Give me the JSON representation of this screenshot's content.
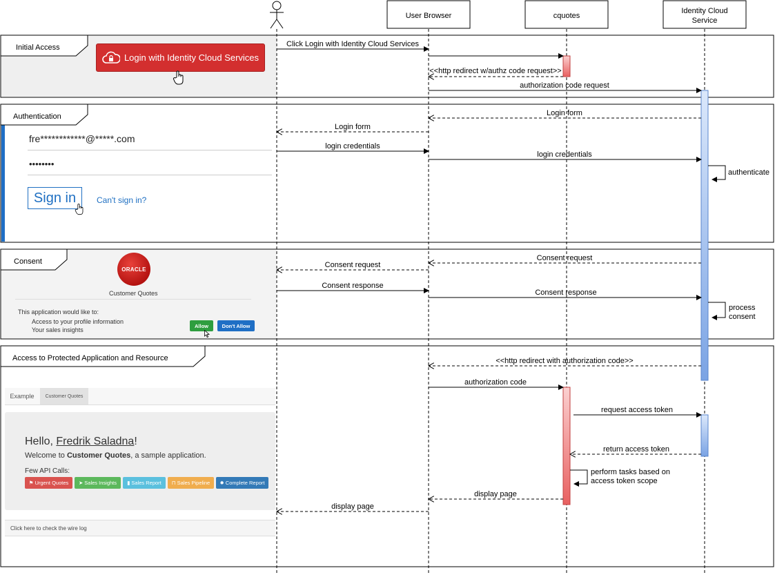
{
  "participants": [
    {
      "id": "user",
      "label": ""
    },
    {
      "id": "browser",
      "label": "User Browser"
    },
    {
      "id": "cquotes",
      "label": "cquotes"
    },
    {
      "id": "idcs",
      "label": "Identity Cloud Service"
    }
  ],
  "idcs_label_lines": [
    "Identity Cloud",
    "Service"
  ],
  "sections": {
    "initial_access": "Initial Access",
    "authentication": "Authentication",
    "consent": "Consent",
    "access_protected": "Access to Protected Application and Resource"
  },
  "messages": {
    "m1": "Click Login with Identity Cloud Services",
    "m3": "<<http redirect w/authz code request>>",
    "m4": "authorization code request",
    "m5": "Login form",
    "m6": "Login form",
    "m7": "login credentials",
    "m8": "login credentials",
    "m9": "authenticate",
    "m10": "Consent request",
    "m11": "Consent request",
    "m12": "Consent response",
    "m13": "Consent response",
    "m14a": "process",
    "m14b": "consent",
    "m15": "<<http redirect with authorization code>>",
    "m16": "authorization code",
    "m17": "request access token",
    "m18": "return access token",
    "m19a": "perform tasks based on",
    "m19b": "access token scope",
    "m20": "display page",
    "m21": "display page"
  },
  "screens": {
    "login_button": "Login with Identity Cloud Services",
    "email": "fre************@*****.com",
    "password": "••••••••",
    "sign_in": "Sign in",
    "cant_sign_in": "Can't sign in?",
    "oracle_logo": "ORACLE",
    "app_name": "Customer Quotes",
    "consent_intro": "This application would like to:",
    "consent_item1": "Access to your profile information",
    "consent_item2": "Your sales insights",
    "allow": "Allow",
    "dont_allow": "Don't Allow",
    "tab_example": "Example",
    "tab_customer_quotes": "Customer Quotes",
    "hello": "Hello, ",
    "user_name": "Fredrik Saladna",
    "hello_end": "!",
    "welcome_pre": "Welcome to ",
    "welcome_app": "Customer Quotes",
    "welcome_post": ", a sample application.",
    "few_api": "Few API Calls:",
    "api_buttons": [
      "Urgent Quotes",
      "Sales Insights",
      "Sales Report",
      "Sales Pipeline",
      "Complete Report"
    ],
    "wire_log": "Click here to check the wire log"
  },
  "colors": {
    "login_red": "#d32f2f",
    "activation_red": "#f28b8b",
    "activation_blue": "#8fb3ea",
    "allow_green": "#2e9e3f",
    "dont_allow_blue": "#1f6fc5",
    "link_blue": "#1e6fc2"
  }
}
